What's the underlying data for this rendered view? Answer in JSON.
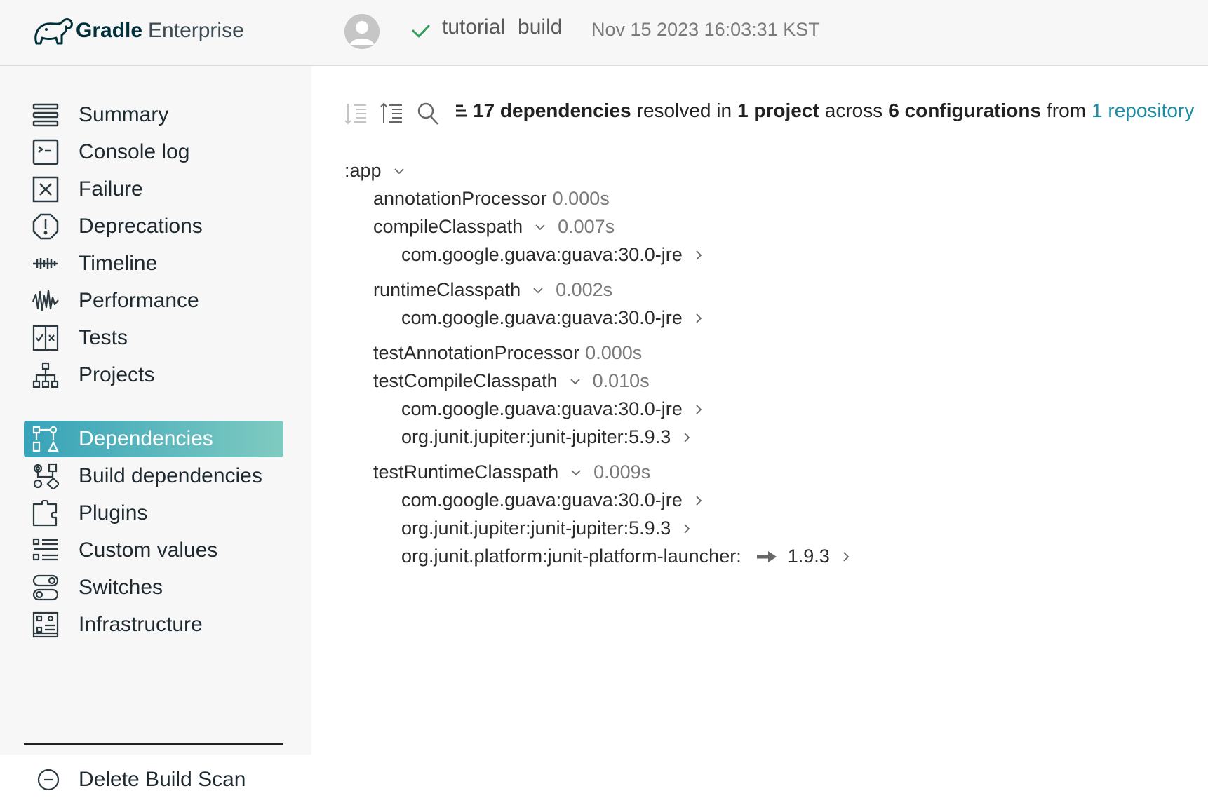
{
  "header": {
    "logo_bold": "Gradle",
    "logo_light": "Enterprise",
    "build_project": "tutorial",
    "build_task": "build",
    "build_date": "Nov 15 2023 16:03:31 KST"
  },
  "sidebar": {
    "items": [
      {
        "label": "Summary",
        "icon": "summary-icon"
      },
      {
        "label": "Console log",
        "icon": "console-icon"
      },
      {
        "label": "Failure",
        "icon": "failure-icon"
      },
      {
        "label": "Deprecations",
        "icon": "deprecations-icon"
      },
      {
        "label": "Timeline",
        "icon": "timeline-icon"
      },
      {
        "label": "Performance",
        "icon": "performance-icon"
      },
      {
        "label": "Tests",
        "icon": "tests-icon"
      },
      {
        "label": "Projects",
        "icon": "projects-icon"
      },
      {
        "label": "Dependencies",
        "icon": "dependencies-icon",
        "active": true
      },
      {
        "label": "Build dependencies",
        "icon": "build-dependencies-icon"
      },
      {
        "label": "Plugins",
        "icon": "plugins-icon"
      },
      {
        "label": "Custom values",
        "icon": "custom-values-icon"
      },
      {
        "label": "Switches",
        "icon": "switches-icon"
      },
      {
        "label": "Infrastructure",
        "icon": "infrastructure-icon"
      }
    ],
    "delete_label": "Delete Build Scan"
  },
  "summary": {
    "dep_count": "17 dependencies",
    "resolved_in": "resolved in",
    "project_count": "1 project",
    "across": "across",
    "config_count": "6 configurations",
    "from": "from",
    "repo_link": "1 repository"
  },
  "tree": {
    "project": ":app",
    "configs": [
      {
        "name": "annotationProcessor",
        "time": "0.000s"
      },
      {
        "name": "compileClasspath",
        "time": "0.007s"
      },
      {
        "name": "runtimeClasspath",
        "time": "0.002s"
      },
      {
        "name": "testAnnotationProcessor",
        "time": "0.000s"
      },
      {
        "name": "testCompileClasspath",
        "time": "0.010s"
      },
      {
        "name": "testRuntimeClasspath",
        "time": "0.009s"
      }
    ],
    "deps": {
      "guava": "com.google.guava:guava:30.0-jre",
      "junit_jupiter": "org.junit.jupiter:junit-jupiter:5.9.3",
      "junit_launcher": "org.junit.platform:junit-platform-launcher:",
      "junit_launcher_version": "1.9.3"
    }
  },
  "colors": {
    "accent": "#1a8ca6",
    "active_gradient_start": "#37a3b9",
    "active_gradient_end": "#7fcbc1",
    "success": "#2e9e5b"
  }
}
